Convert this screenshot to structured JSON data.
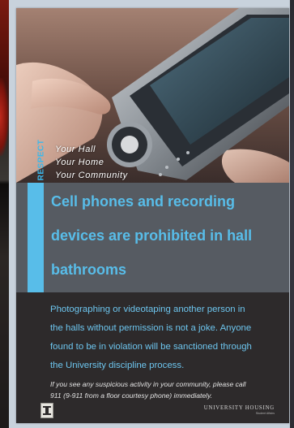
{
  "poster": {
    "side_label": "RESPECT",
    "tagline": [
      "Your Hall",
      "Your Home",
      "Your Community"
    ],
    "headline": [
      "Cell phones and recording",
      "devices are prohibited in hall",
      "bathrooms"
    ],
    "body": [
      "Photographing or videotaping another person in",
      "the halls without permission is not a joke. Anyone",
      "found to be in violation will be sanctioned through",
      "the University discipline process."
    ],
    "notice": [
      "If you see any suspicious activity in your community, please call",
      "911 (9-911 from a floor courtesy phone) immediately."
    ],
    "footer": {
      "housing_name": "UNIVERSITY HOUSING",
      "housing_sub": "Student Affairs"
    },
    "logo_icon": "university-block-i-icon",
    "colors": {
      "accent": "#58bde9",
      "headline_bg": "#565b62",
      "body_bg": "#2d2a2b"
    }
  }
}
